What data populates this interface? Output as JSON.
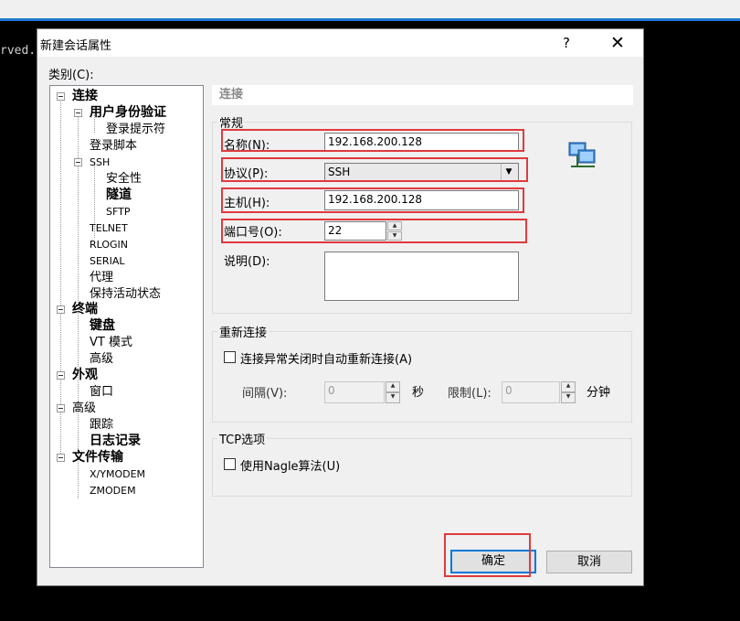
{
  "terminal": {
    "visible_text": "rved."
  },
  "dialog": {
    "title": "新建会话属性",
    "help_glyph": "?",
    "close_glyph": "✕",
    "category_label": "类别(C):",
    "tree": [
      {
        "label": "连接",
        "bold": true,
        "level": 0
      },
      {
        "label": "用户身份验证",
        "bold": true,
        "level": 1
      },
      {
        "label": "登录提示符",
        "bold": false,
        "level": 2
      },
      {
        "label": "登录脚本",
        "bold": false,
        "level": 1
      },
      {
        "label": "SSH",
        "bold": false,
        "level": 1
      },
      {
        "label": "安全性",
        "bold": false,
        "level": 2
      },
      {
        "label": "隧道",
        "bold": true,
        "level": 2
      },
      {
        "label": "SFTP",
        "bold": false,
        "level": 2
      },
      {
        "label": "TELNET",
        "bold": false,
        "level": 1
      },
      {
        "label": "RLOGIN",
        "bold": false,
        "level": 1
      },
      {
        "label": "SERIAL",
        "bold": false,
        "level": 1
      },
      {
        "label": "代理",
        "bold": false,
        "level": 1
      },
      {
        "label": "保持活动状态",
        "bold": false,
        "level": 1
      },
      {
        "label": "终端",
        "bold": true,
        "level": 0
      },
      {
        "label": "键盘",
        "bold": true,
        "level": 1
      },
      {
        "label": "VT 模式",
        "bold": false,
        "level": 1
      },
      {
        "label": "高级",
        "bold": false,
        "level": 1
      },
      {
        "label": "外观",
        "bold": true,
        "level": 0
      },
      {
        "label": "窗口",
        "bold": false,
        "level": 1
      },
      {
        "label": "高级",
        "bold": false,
        "level": 0
      },
      {
        "label": "跟踪",
        "bold": false,
        "level": 1
      },
      {
        "label": "日志记录",
        "bold": true,
        "level": 1
      },
      {
        "label": "文件传输",
        "bold": true,
        "level": 0
      },
      {
        "label": "X/YMODEM",
        "bold": false,
        "level": 1
      },
      {
        "label": "ZMODEM",
        "bold": false,
        "level": 1
      }
    ],
    "section_title": "连接",
    "general": {
      "group_title": "常规",
      "name_label": "名称(N):",
      "name_value": "192.168.200.128",
      "protocol_label": "协议(P):",
      "protocol_value": "SSH",
      "host_label": "主机(H):",
      "host_value": "192.168.200.128",
      "port_label": "端口号(O):",
      "port_value": "22",
      "desc_label": "说明(D):",
      "desc_value": ""
    },
    "reconnect": {
      "group_title": "重新连接",
      "auto_label": "连接异常关闭时自动重新连接(A)",
      "interval_label": "间隔(V):",
      "interval_value": "0",
      "interval_unit": "秒",
      "limit_label": "限制(L):",
      "limit_value": "0",
      "limit_unit": "分钟"
    },
    "tcp": {
      "group_title": "TCP选项",
      "nagle_label": "使用Nagle算法(U)"
    },
    "buttons": {
      "ok": "确定",
      "cancel": "取消"
    },
    "colors": {
      "highlight_red": "#e0393d",
      "accent_blue": "#0078d7"
    }
  }
}
